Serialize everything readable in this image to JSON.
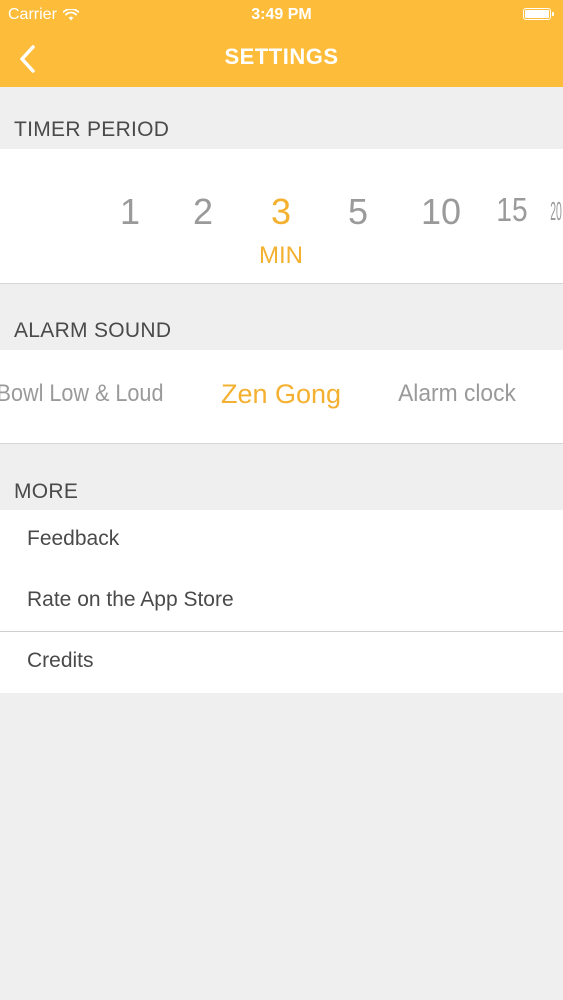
{
  "status_bar": {
    "carrier": "Carrier",
    "time": "3:49 PM"
  },
  "nav": {
    "title": "SETTINGS",
    "back_icon": "chevron-left-icon"
  },
  "timer": {
    "header": "TIMER PERIOD",
    "options": [
      "1",
      "2",
      "3",
      "5",
      "10",
      "15",
      "20"
    ],
    "selected": "3",
    "unit": "MIN"
  },
  "alarm": {
    "header": "ALARM SOUND",
    "options": [
      "Bowl Low & Loud",
      "Zen Gong",
      "Alarm clock"
    ],
    "selected": "Zen Gong"
  },
  "more": {
    "header": "MORE",
    "items": [
      {
        "label": "Feedback"
      },
      {
        "label": "Rate on the App Store"
      },
      {
        "label": "Credits"
      }
    ]
  },
  "colors": {
    "header_bg": "#fdbd3a",
    "accent": "#f4b02f",
    "muted_text": "#9a9a9a",
    "background": "#efeff0"
  }
}
